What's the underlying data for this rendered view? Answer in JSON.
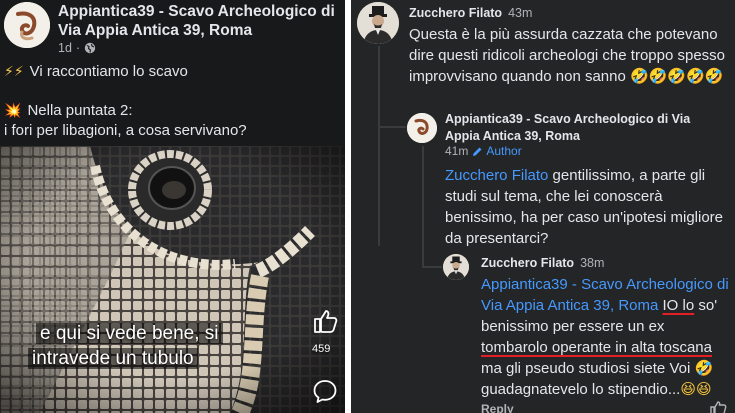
{
  "post": {
    "page_name": "Appiantica39 - Scavo Archeologico di Via Appia Antica 39, Roma",
    "age": "1d",
    "dot": "·",
    "line1_emoji": "⚡⚡",
    "line1": "Vi raccontiamo lo scavo",
    "line2_emoji": "💥",
    "line2": "Nella puntata 2:",
    "line3": "i fori per libagioni, a cosa servivano?",
    "video": {
      "subtitle_1": "e qui si vede bene, si",
      "subtitle_2": "intravede un tubulo",
      "like_count": "459",
      "like_icon": "thumbs-up-icon",
      "comment_icon": "comment-icon"
    }
  },
  "comments": {
    "comment1": {
      "author": "Zucchero Filato",
      "time": "43m",
      "text": "Questa è la più assurda cazzata che potevano dire questi ridicoli archeologi che troppo spesso improvvisano quando non sanno",
      "emojis": "🤣🤣🤣🤣🤣"
    },
    "reply1": {
      "author": "Appiantica39 - Scavo Archeologico di Via Appia Antica 39, Roma",
      "time": "41m",
      "badge": "Author",
      "mention": "Zucchero Filato",
      "text": " gentilissimo, a parte gli studi sul tema, che lei conoscerà benissimo, ha per caso un'ipotesi migliore da presentarci?"
    },
    "reply2": {
      "author": "Zucchero Filato",
      "time": "38m",
      "mention": "Appiantica39 - Scavo Archeologico di Via Appia Antica 39, Roma",
      "underlined_1": "IO lo",
      "text_mid": "so' benissimo per essere un ex",
      "underlined_2": "tombarolo operante in alta toscana",
      "text_end": " ma gli pseudo studiosi siete Voi",
      "text_last": "guadagnatevelo lo stipendio...",
      "emoji_a": "🤣",
      "emoji_b": "😆😆"
    },
    "reply_label": "Reply"
  },
  "colors": {
    "left_bg": "#18191a",
    "right_bg": "#242526",
    "mention": "#4599ff",
    "underline": "#e41e26"
  }
}
